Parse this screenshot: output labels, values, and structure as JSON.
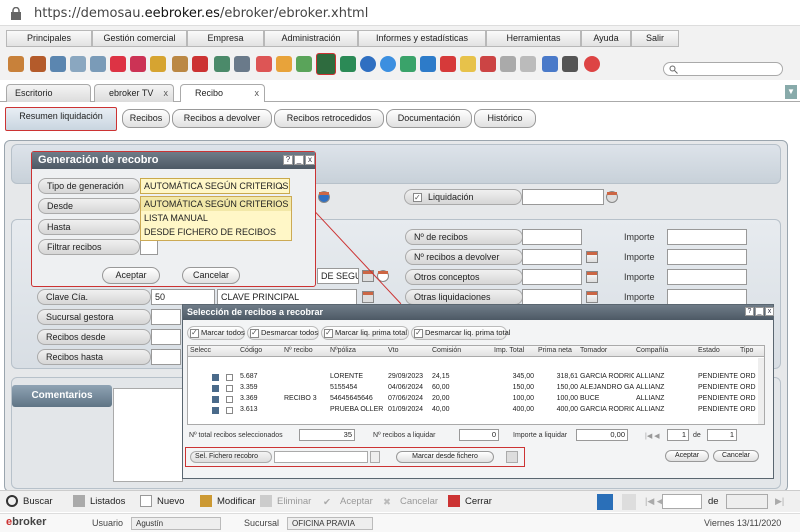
{
  "browser": {
    "url_prefix": "https://demosau.",
    "url_host": "eebroker.es",
    "url_path": "/ebroker/ebroker.xhtml"
  },
  "menu": [
    "Principales",
    "Gestión comercial",
    "Empresa",
    "Administración",
    "Informes y estadísticas",
    "Herramientas",
    "Ayuda",
    "Salir"
  ],
  "tabs": {
    "t1": "Escritorio",
    "t2": "ebroker TV",
    "t3": "Recibo",
    "close": "x"
  },
  "subtabs": [
    "Resumen liquidación",
    "Recibos",
    "Recibos a devolver",
    "Recibos retrocedidos",
    "Documentación",
    "Histórico"
  ],
  "left_form": {
    "clave_cia": "Clave Cía.",
    "clave_cia_val": "50",
    "clave_cia_name": "CLAVE PRINCIPAL",
    "sucursal_gestora": "Sucursal gestora",
    "recibos_desde": "Recibos desde",
    "recibos_hasta": "Recibos hasta",
    "hidden_field": "DE SEGUR"
  },
  "right_form": {
    "liquidacion": "Liquidación",
    "n_recibos": "Nº de recibos",
    "n_recibos_devolver": "Nº recibos a devolver",
    "otros_conceptos": "Otros conceptos",
    "otras_liquidaciones": "Otras liquidaciones",
    "importe": "Importe"
  },
  "comentarios": "Comentarios",
  "gen_dialog": {
    "title": "Generación de recobro",
    "tipo_label": "Tipo de generación",
    "tipo_value": "AUTOMÁTICA SEGÚN CRITERIOS",
    "desde": "Desde",
    "hasta": "Hasta",
    "filtrar": "Filtrar recibos",
    "options": [
      "AUTOMÁTICA SEGÚN CRITERIOS",
      "LISTA MANUAL",
      "DESDE FICHERO DE RECIBOS"
    ],
    "aceptar": "Aceptar",
    "cancelar": "Cancelar",
    "help": "?",
    "minimize": "_",
    "close": "x"
  },
  "sel_dialog": {
    "title": "Selección de recibos a recobrar",
    "actions": [
      "Marcar todos",
      "Desmarcar todos",
      "Marcar liq. prima total",
      "Desmarcar liq. prima total"
    ],
    "columns": [
      "Selecc",
      "Código",
      "Nº recibo",
      "Nºpóliza",
      "Vto",
      "Comisión",
      "Imp. Total",
      "Prima neta",
      "Tomador",
      "Compañía",
      "Estado",
      "Tipo"
    ],
    "rows": [
      [
        "5.687",
        "",
        "LORENTE",
        "29/09/2023",
        "24,15",
        "345,00",
        "318,61",
        "GARCIA RODRIG",
        "ALLIANZ",
        "PENDIENTE,C",
        "ORD"
      ],
      [
        "3.359",
        "",
        "5155454",
        "04/06/2024",
        "60,00",
        "150,00",
        "150,00",
        "ALEJANDRO GAR",
        "ALLIANZ",
        "PENDIENTE,C",
        "ORD"
      ],
      [
        "3.369",
        "RECIBO 3",
        "54645645646",
        "07/06/2024",
        "20,00",
        "100,00",
        "100,00",
        "BUCE",
        "ALLIANZ",
        "PENDIENTE,C",
        "ORD"
      ],
      [
        "3.613",
        "",
        "PRUEBA OLLER",
        "01/09/2024",
        "40,00",
        "400,00",
        "400,00",
        "GARCIA RODRIG",
        "ALLIANZ",
        "PENDIENTE,C",
        "ORD"
      ]
    ],
    "total_sel_label": "Nº total recibos seleccionados",
    "total_sel": "35",
    "a_liquidar_label": "Nº recibos a liquidar",
    "a_liquidar": "0",
    "importe_label": "Importe a liquidar",
    "importe": "0,00",
    "page": "1",
    "page_total": "1",
    "sel_fichero": "Sel. Fichero recobro",
    "marcar_fichero": "Marcar desde fichero",
    "aceptar": "Aceptar",
    "cancelar": "Cancelar"
  },
  "bottom": {
    "buscar": "Buscar",
    "listados": "Listados",
    "nuevo": "Nuevo",
    "modificar": "Modificar",
    "eliminar": "Eliminar",
    "aceptar": "Aceptar",
    "cancelar": "Cancelar",
    "cerrar": "Cerrar",
    "de": "de"
  },
  "status": {
    "logo": "ebroker",
    "usuario_label": "Usuario",
    "usuario": "Agustín",
    "sucursal_label": "Sucursal",
    "sucursal": "OFICINA PRAVIA",
    "date": "Viernes 13/11/2020"
  }
}
